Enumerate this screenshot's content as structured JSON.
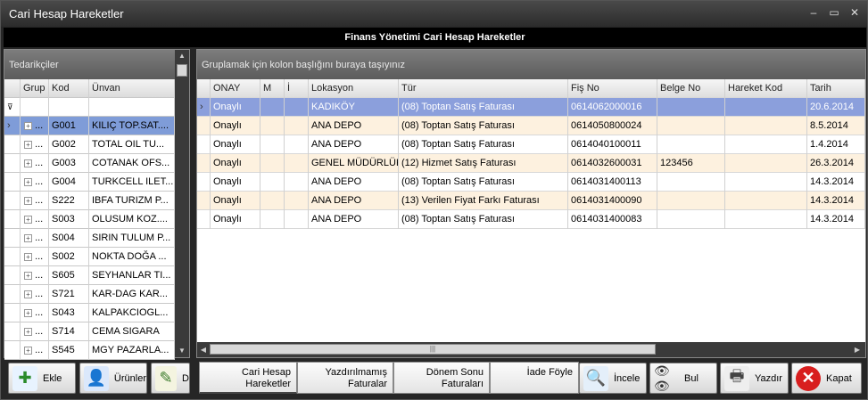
{
  "window": {
    "title": "Cari Hesap Hareketler"
  },
  "header": {
    "title": "Finans Yönetimi Cari Hesap Hareketler"
  },
  "left_panel": {
    "caption": "Tedarikçiler",
    "columns": [
      "Grup",
      "Kod",
      "Ünvan"
    ],
    "rows": [
      {
        "grup": "...",
        "kod": "G001",
        "unvan": "KILIÇ TOP.SAT...."
      },
      {
        "grup": "...",
        "kod": "G002",
        "unvan": "TOTAL OIL TU..."
      },
      {
        "grup": "...",
        "kod": "G003",
        "unvan": "COTANAK OFS..."
      },
      {
        "grup": "...",
        "kod": "G004",
        "unvan": "TURKCELL ILET..."
      },
      {
        "grup": "...",
        "kod": "S222",
        "unvan": "IBFA TURIZM P..."
      },
      {
        "grup": "...",
        "kod": "S003",
        "unvan": "OLUSUM KOZ...."
      },
      {
        "grup": "...",
        "kod": "S004",
        "unvan": "SIRIN TULUM P..."
      },
      {
        "grup": "...",
        "kod": "S002",
        "unvan": "NOKTA DOĞA ..."
      },
      {
        "grup": "...",
        "kod": "S605",
        "unvan": "SEYHANLAR TI..."
      },
      {
        "grup": "...",
        "kod": "S721",
        "unvan": "KAR-DAG KAR..."
      },
      {
        "grup": "...",
        "kod": "S043",
        "unvan": "KALPAKCIOGL..."
      },
      {
        "grup": "...",
        "kod": "S714",
        "unvan": "CEMA SIGARA"
      },
      {
        "grup": "...",
        "kod": "S545",
        "unvan": "MGY PAZARLA..."
      }
    ]
  },
  "right_panel": {
    "caption": "Gruplamak için kolon başlığını buraya taşıyınız",
    "columns": [
      "ONAY",
      "M",
      "İ",
      "Lokasyon",
      "Tür",
      "Fiş No",
      "Belge No",
      "Hareket Kod",
      "Tarih"
    ],
    "rows": [
      {
        "onay": "Onaylı",
        "m": "",
        "i": "",
        "lokasyon": "KADIKÖY",
        "tur": "(08) Toptan Satış Faturası",
        "fis": "0614062000016",
        "belge": "",
        "hareket": "",
        "tarih": "20.6.2014"
      },
      {
        "onay": "Onaylı",
        "m": "",
        "i": "",
        "lokasyon": "ANA DEPO",
        "tur": "(08) Toptan Satış Faturası",
        "fis": "0614050800024",
        "belge": "",
        "hareket": "",
        "tarih": "8.5.2014"
      },
      {
        "onay": "Onaylı",
        "m": "",
        "i": "",
        "lokasyon": "ANA DEPO",
        "tur": "(08) Toptan Satış Faturası",
        "fis": "0614040100011",
        "belge": "",
        "hareket": "",
        "tarih": "1.4.2014"
      },
      {
        "onay": "Onaylı",
        "m": "",
        "i": "",
        "lokasyon": "GENEL MÜDÜRLÜK",
        "tur": "(12) Hizmet Satış Faturası",
        "fis": "0614032600031",
        "belge": "123456",
        "hareket": "",
        "tarih": "26.3.2014"
      },
      {
        "onay": "Onaylı",
        "m": "",
        "i": "",
        "lokasyon": "ANA DEPO",
        "tur": "(08) Toptan Satış Faturası",
        "fis": "0614031400113",
        "belge": "",
        "hareket": "",
        "tarih": "14.3.2014"
      },
      {
        "onay": "Onaylı",
        "m": "",
        "i": "",
        "lokasyon": "ANA DEPO",
        "tur": "(13) Verilen Fiyat Farkı Faturası",
        "fis": "0614031400090",
        "belge": "",
        "hareket": "",
        "tarih": "14.3.2014"
      },
      {
        "onay": "Onaylı",
        "m": "",
        "i": "",
        "lokasyon": "ANA DEPO",
        "tur": "(08) Toptan Satış Faturası",
        "fis": "0614031400083",
        "belge": "",
        "hareket": "",
        "tarih": "14.3.2014"
      }
    ]
  },
  "left_buttons": [
    {
      "label": "Ekle",
      "icon": "add-document-icon"
    },
    {
      "label": "Ürünler",
      "icon": "user-icon"
    },
    {
      "label": "D",
      "icon": "edit-icon"
    }
  ],
  "tabs": [
    {
      "line1": "Cari Hesap",
      "line2": "Hareketler"
    },
    {
      "line1": "Yazdırılmamış",
      "line2": "Faturalar"
    },
    {
      "line1": "Dönem Sonu",
      "line2": "Faturaları"
    },
    {
      "line1": "İade Föyle",
      "line2": ""
    }
  ],
  "right_buttons": [
    {
      "label": "İncele",
      "icon": "magnifier-icon"
    },
    {
      "label": "Bul",
      "icon": "binoculars-icon"
    },
    {
      "label": "Yazdır",
      "icon": "printer-icon"
    },
    {
      "label": "Kapat",
      "icon": "close-icon"
    }
  ],
  "colors": {
    "selected_row": "#8b9fdc",
    "alt_row": "#fdf1df",
    "header_bar": "#000000"
  }
}
